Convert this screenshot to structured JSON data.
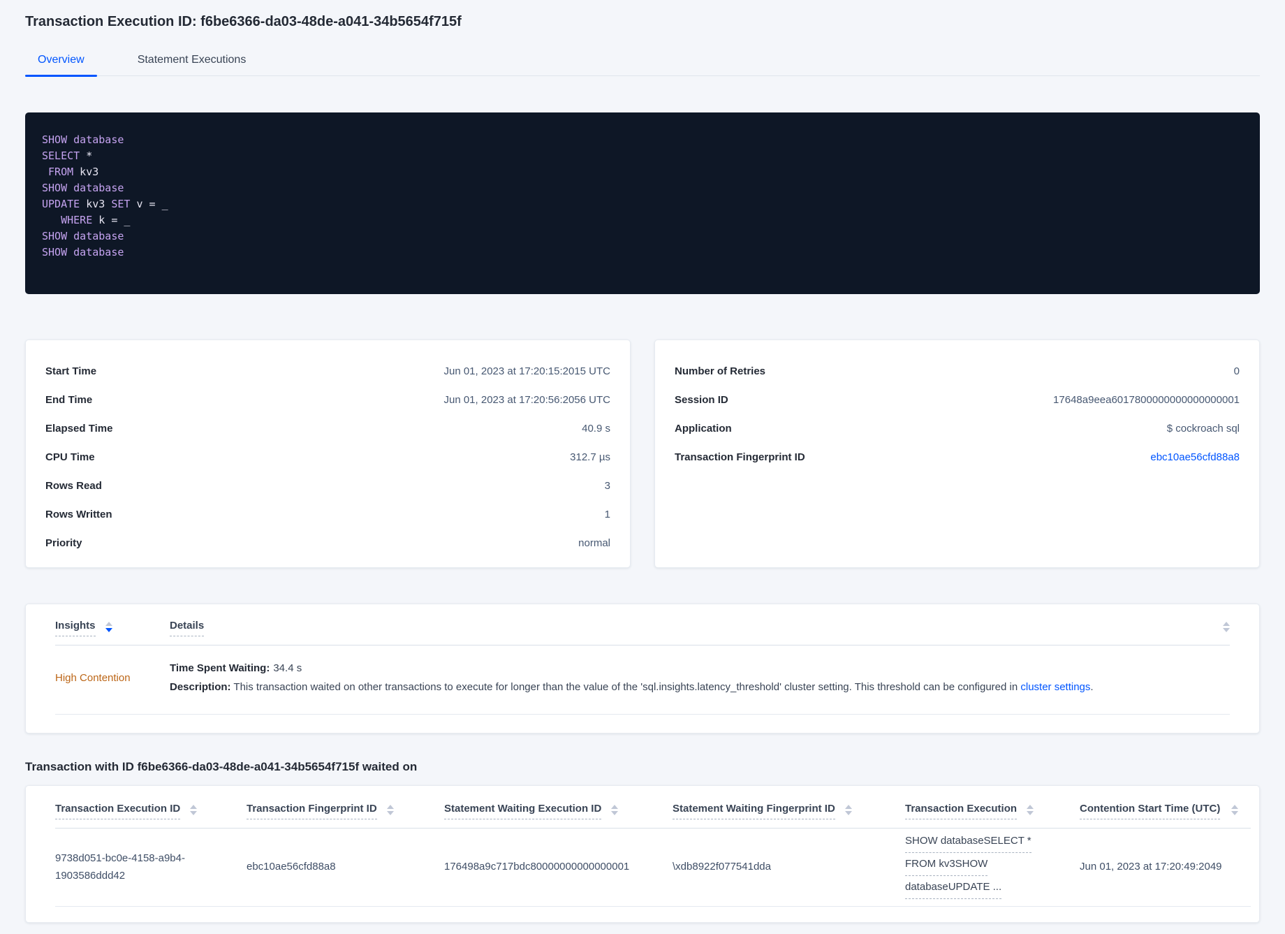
{
  "page": {
    "title": "Transaction Execution ID: f6be6366-da03-48de-a041-34b5654f715f",
    "tabs": [
      {
        "label": "Overview"
      },
      {
        "label": "Statement Executions"
      }
    ]
  },
  "sql": {
    "lines": [
      [
        {
          "text": "SHOW database",
          "type": "kw"
        }
      ],
      [
        {
          "text": "SELECT",
          "type": "kw"
        },
        {
          "text": " *",
          "type": "plain"
        }
      ],
      [
        {
          "text": " ",
          "type": "plain"
        },
        {
          "text": "FROM",
          "type": "kw"
        },
        {
          "text": " kv3",
          "type": "plain"
        }
      ],
      [
        {
          "text": "SHOW database",
          "type": "kw"
        }
      ],
      [
        {
          "text": "UPDATE",
          "type": "kw"
        },
        {
          "text": " kv3 ",
          "type": "plain"
        },
        {
          "text": "SET",
          "type": "kw"
        },
        {
          "text": " v = _",
          "type": "plain"
        }
      ],
      [
        {
          "text": "   ",
          "type": "plain"
        },
        {
          "text": "WHERE",
          "type": "kw"
        },
        {
          "text": " k = _",
          "type": "plain"
        }
      ],
      [
        {
          "text": "SHOW database",
          "type": "kw"
        }
      ],
      [
        {
          "text": "SHOW database",
          "type": "kw"
        }
      ]
    ]
  },
  "exec_card": {
    "rows": [
      {
        "label": "Start Time",
        "value": "Jun 01, 2023 at 17:20:15:2015 UTC"
      },
      {
        "label": "End Time",
        "value": "Jun 01, 2023 at 17:20:56:2056 UTC"
      },
      {
        "label": "Elapsed Time",
        "value": "40.9 s"
      },
      {
        "label": "CPU Time",
        "value": "312.7 µs"
      },
      {
        "label": "Rows Read",
        "value": "3"
      },
      {
        "label": "Rows Written",
        "value": "1"
      },
      {
        "label": "Priority",
        "value": "normal"
      }
    ]
  },
  "session_card": {
    "rows": [
      {
        "label": "Number of Retries",
        "value": "0"
      },
      {
        "label": "Session ID",
        "value": "17648a9eea6017800000000000000001"
      },
      {
        "label": "Application",
        "value": "$ cockroach sql"
      },
      {
        "label": "Transaction Fingerprint ID",
        "value": "ebc10ae56cfd88a8"
      }
    ]
  },
  "insights": {
    "col_insights": "Insights",
    "col_details": "Details",
    "row": {
      "insight": "High Contention",
      "waiting_label": "Time Spent Waiting:",
      "waiting_value": "34.4 s",
      "desc_label": "Description:",
      "desc_text": " This transaction waited on other transactions to execute for longer than the value of the 'sql.insights.latency_threshold' cluster setting. This threshold can be configured in ",
      "link_text": "cluster settings",
      "desc_suffix": "."
    }
  },
  "waited_on": {
    "heading": "Transaction with ID f6be6366-da03-48de-a041-34b5654f715f waited on",
    "columns": [
      "Transaction Execution ID",
      "Transaction Fingerprint ID",
      "Statement Waiting Execution ID",
      "Statement Waiting Fingerprint ID",
      "Transaction Execution",
      "Contention Start Time (UTC)"
    ],
    "row": {
      "txn_execution_id": "9738d051-bc0e-4158-a9b4-1903586ddd42",
      "txn_fingerprint_id": "ebc10ae56cfd88a8",
      "stmt_waiting_execution_id": "176498a9c717bdc80000000000000001",
      "stmt_waiting_fingerprint_id": "\\xdb8922f077541dda",
      "txn_execution_lines": [
        "SHOW databaseSELECT *",
        "FROM kv3SHOW",
        "databaseUPDATE ..."
      ],
      "contention_start": "Jun 01, 2023 at 17:20:49:2049"
    }
  },
  "colors": {
    "accent_blue": "#0055ff",
    "contention_orange": "#bc6617",
    "code_bg": "#0e1726",
    "code_keyword": "#c5a3f0",
    "code_text": "#e7e5f2",
    "page_bg": "#f4f6fa",
    "ink": "#242a35",
    "text_muted": "#475872"
  }
}
